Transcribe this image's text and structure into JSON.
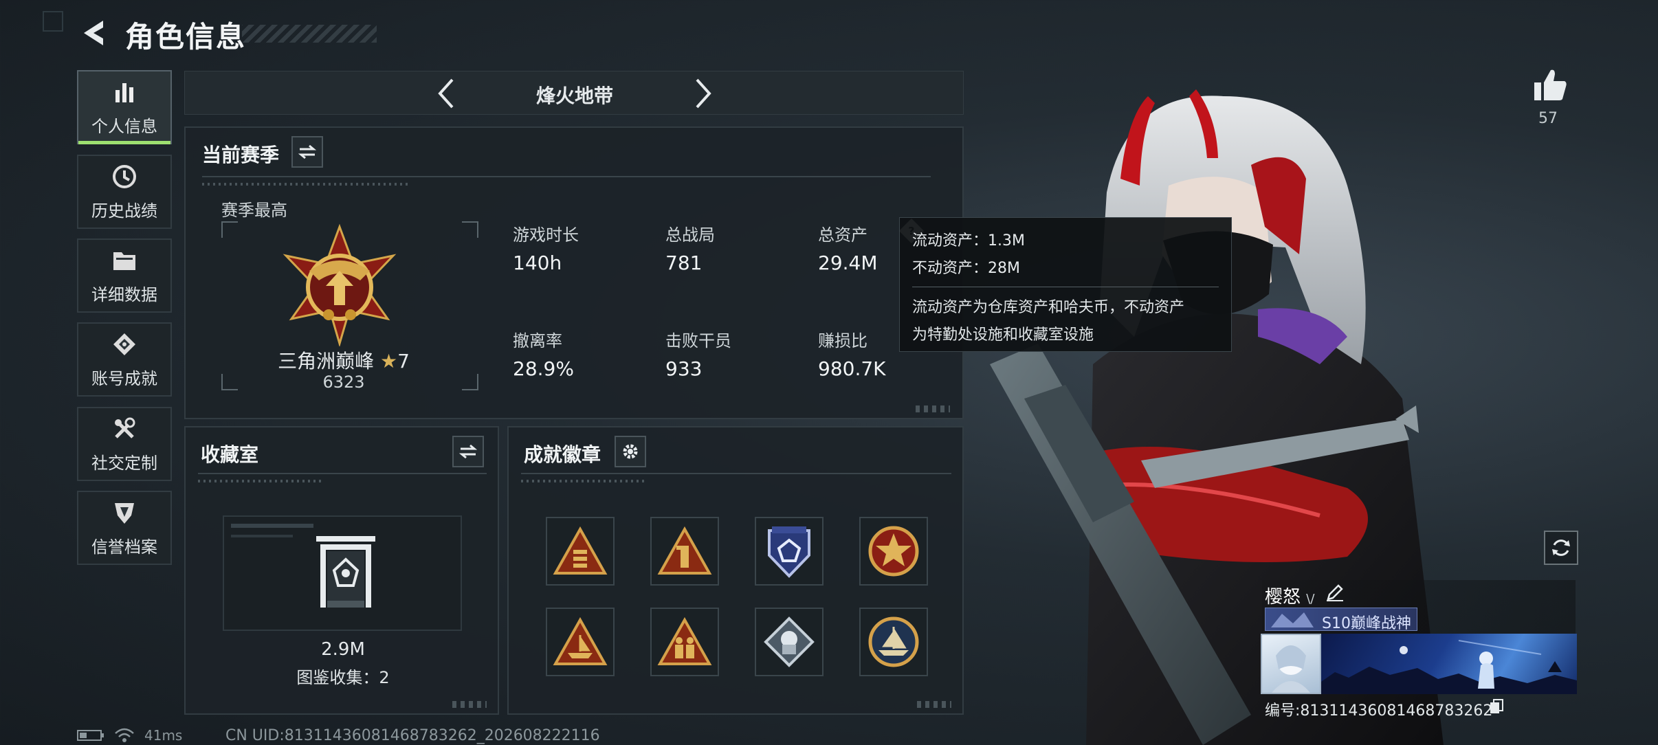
{
  "header": {
    "title": "角色信息"
  },
  "sidebar": {
    "items": [
      {
        "label": "个人信息",
        "icon": "bar-chart-icon",
        "active": true
      },
      {
        "label": "历史战绩",
        "icon": "history-icon",
        "active": false
      },
      {
        "label": "详细数据",
        "icon": "folder-icon",
        "active": false
      },
      {
        "label": "账号成就",
        "icon": "achievement-icon",
        "active": false
      },
      {
        "label": "社交定制",
        "icon": "tools-icon",
        "active": false
      },
      {
        "label": "信誉档案",
        "icon": "shield-icon",
        "active": false
      }
    ]
  },
  "map_selector": {
    "current": "烽火地带"
  },
  "season": {
    "title": "当前赛季",
    "best_label": "赛季最高",
    "rank_name": "三角洲巅峰",
    "rank_stars": "7",
    "rank_score": "6323",
    "stats": [
      {
        "label": "游戏时长",
        "value": "140h"
      },
      {
        "label": "总战局",
        "value": "781"
      },
      {
        "label": "总资产",
        "value": "29.4M"
      },
      {
        "label": "撤离率",
        "value": "28.9%"
      },
      {
        "label": "击败干员",
        "value": "933"
      },
      {
        "label": "赚损比",
        "value": "980.7K"
      }
    ]
  },
  "tooltip": {
    "line1": "流动资产：1.3M",
    "line2": "不动资产：28M",
    "desc1": "流动资产为仓库资产和哈夫币，不动资产",
    "desc2": "为特勤处设施和收藏室设施"
  },
  "collection": {
    "title": "收藏室",
    "value": "2.9M",
    "catalog": "图鉴收集：2"
  },
  "badges": {
    "title": "成就徽章",
    "items": [
      "badge-triangle-bars",
      "badge-triangle-one",
      "badge-shield-blue",
      "badge-star-emblem",
      "badge-triangle-ship",
      "badge-triangle-soldiers",
      "badge-diamond-hand",
      "badge-round-ship"
    ]
  },
  "profile": {
    "likes": "57",
    "nickname": "樱怒",
    "title": "S10巅峰战神",
    "serial": "编号:81311436081468783262"
  },
  "status": {
    "ping": "41ms",
    "uid": "CN UID:81311436081468783262_202608222116"
  },
  "colors": {
    "accent_green": "#9ee070",
    "panel_border": "#323c42"
  }
}
